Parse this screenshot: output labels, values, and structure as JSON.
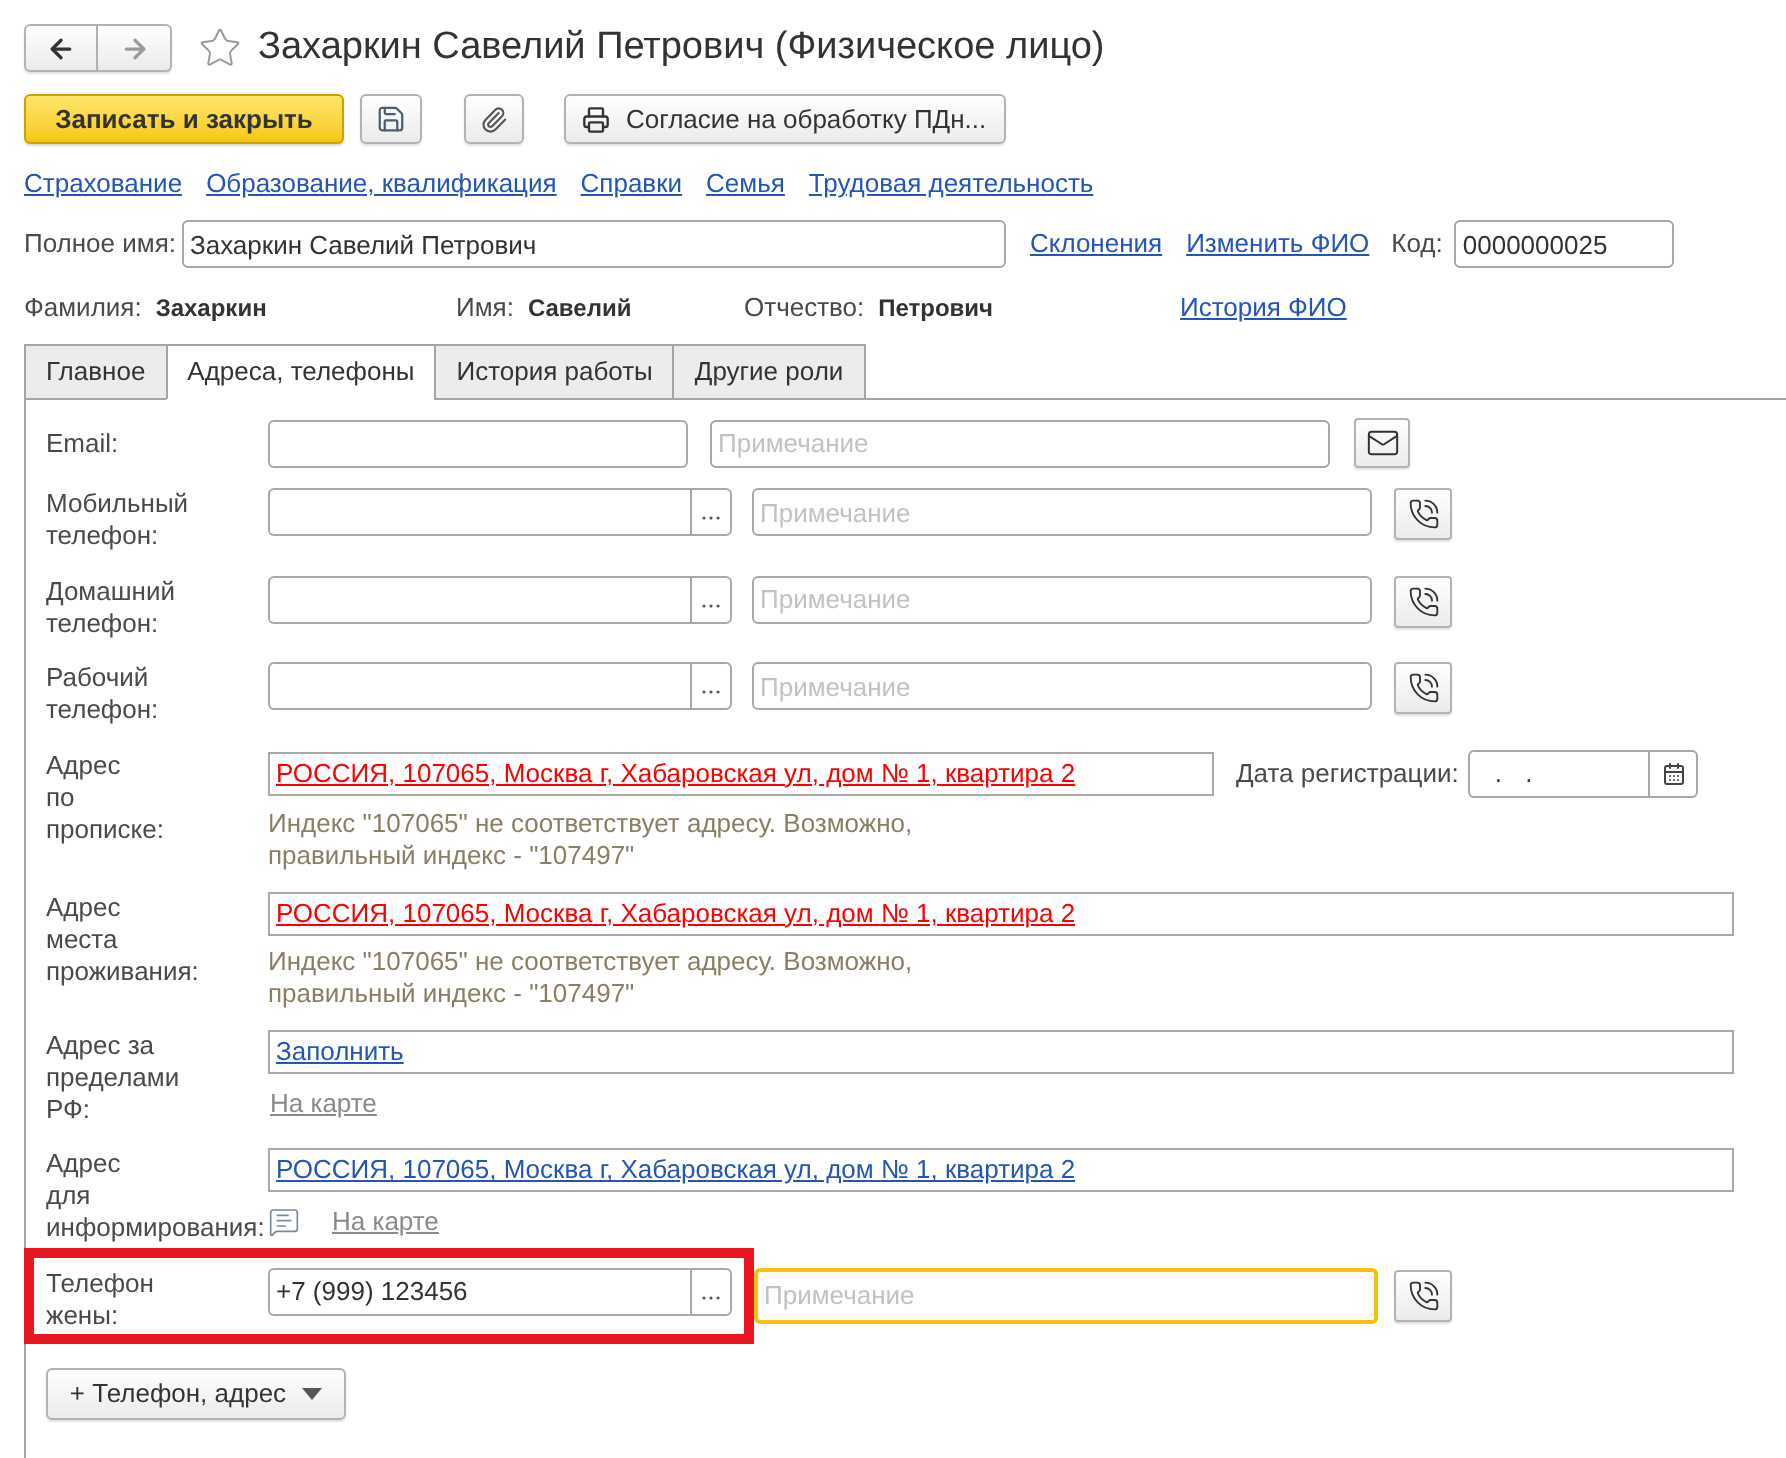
{
  "window": {
    "title": "Захаркин Савелий Петрович (Физическое лицо)",
    "favorite": false
  },
  "navigation": {
    "forward_disabled": true
  },
  "toolbar": {
    "save_close": "Записать и закрыть",
    "print": "Согласие на обработку ПДн..."
  },
  "links": [
    "Страхование",
    "Образование, квалификация",
    "Справки",
    "Семья",
    "Трудовая деятельность"
  ],
  "full_name": {
    "label": "Полное имя:",
    "value": "Захаркин Савелий Петрович",
    "links": [
      "Склонения",
      "Изменить ФИО"
    ],
    "code_label": "Код:",
    "code": "0000000025"
  },
  "name_parts": [
    {
      "label": "Фамилия:",
      "value": "Захаркин"
    },
    {
      "label": "Имя:",
      "value": "Савелий"
    },
    {
      "label": "Отчество:",
      "value": "Петрович"
    }
  ],
  "name_history_link": "История ФИО",
  "tabs": [
    {
      "label": "Главное",
      "selected": false
    },
    {
      "label": "Адреса, телефоны",
      "selected": true
    },
    {
      "label": "История работы",
      "selected": false
    },
    {
      "label": "Другие роли",
      "selected": false
    }
  ],
  "contacts": [
    {
      "kind": "email",
      "label": "Email:",
      "note_placeholder": "Примечание"
    },
    {
      "kind": "phone",
      "label": "Мобильный\nтелефон:",
      "note_placeholder": "Примечание"
    },
    {
      "kind": "phone",
      "label": "Домашний\nтелефон:",
      "note_placeholder": "Примечание"
    },
    {
      "kind": "phone",
      "label": "Рабочий\nтелефон:",
      "note_placeholder": "Примечание"
    },
    {
      "kind": "address",
      "label": "Адрес\nпо\nпрописке:",
      "value": "РОССИЯ, 107065, Москва г, Хабаровская ул, дом № 1, квартира 2",
      "valid": false,
      "date_label": "Дата регистрации:",
      "date_value": ". .",
      "warning": "Индекс \"107065\" не соответствует адресу. Возможно, правильный индекс - \"107497\""
    },
    {
      "kind": "address",
      "label": "Адрес\nместа\nпроживания:",
      "value": "РОССИЯ, 107065, Москва г, Хабаровская ул, дом № 1, квартира 2",
      "valid": false,
      "warning": "Индекс \"107065\" не соответствует адресу. Возможно, правильный индекс - \"107497\""
    },
    {
      "kind": "address",
      "label": "Адрес за\nпределами\nРФ:",
      "value": "Заполнить",
      "valid": true,
      "map_link": "На карте"
    },
    {
      "kind": "address",
      "label": "Адрес\nдля\nинформирования:",
      "value": "РОССИЯ, 107065, Москва г, Хабаровская ул, дом № 1, квартира 2",
      "valid": true,
      "has_comment": true,
      "map_link": "На карте"
    },
    {
      "kind": "phone",
      "label": "Телефон\nжены:",
      "value": "+7 (999) 123456",
      "note_placeholder": "Примечание",
      "note_focused": true,
      "highlighted": true
    }
  ],
  "add_button": "+ Телефон, адрес"
}
